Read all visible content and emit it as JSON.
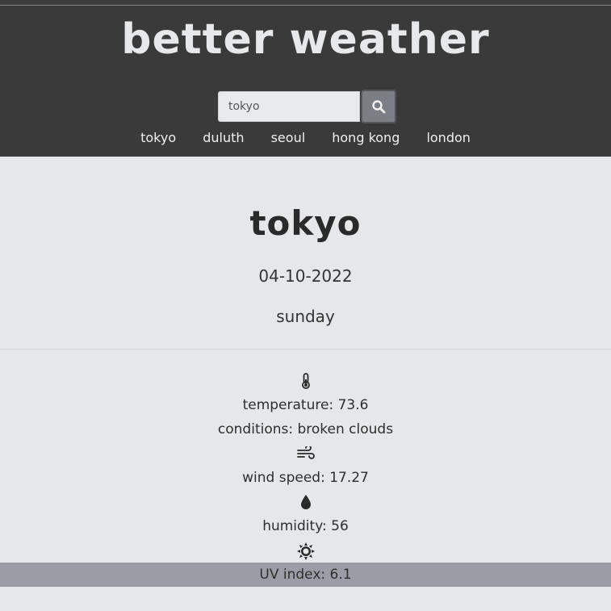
{
  "header": {
    "brand": "better weather",
    "search": {
      "value": "tokyo",
      "placeholder": "tokyo"
    },
    "search_button_icon": "search-icon",
    "nav": [
      "tokyo",
      "duluth",
      "seoul",
      "hong kong",
      "london"
    ]
  },
  "main": {
    "city": "tokyo",
    "date": "04-10-2022",
    "day": "sunday",
    "stats": {
      "temperature_icon": "thermometer-icon",
      "temperature": "temperature: 73.6",
      "conditions": "conditions: broken clouds",
      "wind_icon": "wind-icon",
      "wind_speed": "wind speed: 17.27",
      "humidity_icon": "droplet-icon",
      "humidity": "humidity: 56",
      "uv_icon": "sun-icon",
      "uv_index": "UV index: 6.1"
    }
  },
  "colors": {
    "header_bg": "#3a3a3a",
    "page_bg": "#e6e7e9",
    "uv_band": "#9b9ca6",
    "search_button": "#7b7e85"
  }
}
